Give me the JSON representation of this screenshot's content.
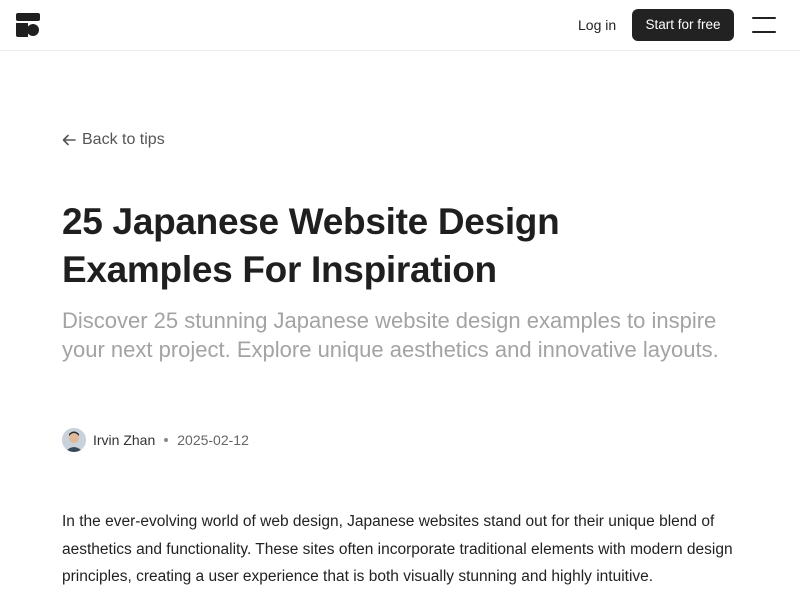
{
  "header": {
    "logo_icon": "brand-logo-icon",
    "login_label": "Log in",
    "cta_label": "Start for free",
    "menu_icon": "hamburger-menu-icon"
  },
  "article": {
    "back_label": "Back to tips",
    "title": "25 Japanese Website Design Examples For Inspiration",
    "subtitle": "Discover 25 stunning Japanese website design examples to inspire your next project. Explore unique aesthetics and innovative layouts.",
    "author": "Irvin Zhan",
    "date": "2025-02-12",
    "intro": "In the ever-evolving world of web design, Japanese websites stand out for their unique blend of aesthetics and functionality. These sites often incorporate traditional elements with modern design principles, creating a user experience that is both visually stunning and highly intuitive."
  },
  "colors": {
    "primary_button": "#222222",
    "subtitle_text": "#a3a3a3",
    "divider": "#ececec"
  }
}
